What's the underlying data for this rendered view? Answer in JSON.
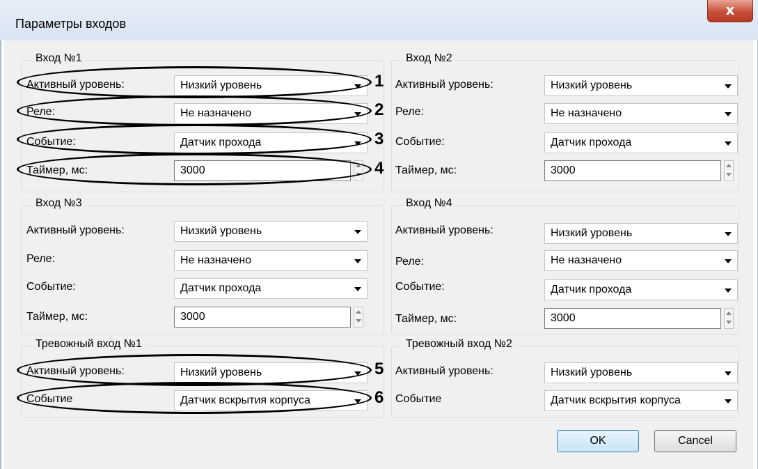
{
  "window": {
    "title": "Параметры входов",
    "close_glyph": "x"
  },
  "groups": {
    "in1": {
      "title": "Вход №1",
      "active_label": "Активный уровень:",
      "active_value": "Низкий уровень",
      "relay_label": "Реле:",
      "relay_value": "Не назначено",
      "event_label": "Событие:",
      "event_value": "Датчик прохода",
      "timer_label": "Таймер, мс:",
      "timer_value": "3000"
    },
    "in2": {
      "title": "Вход №2",
      "active_label": "Активный уровень:",
      "active_value": "Низкий уровень",
      "relay_label": "Реле:",
      "relay_value": "Не назначено",
      "event_label": "Событие:",
      "event_value": "Датчик прохода",
      "timer_label": "Таймер, мс:",
      "timer_value": "3000"
    },
    "in3": {
      "title": "Вход №3",
      "active_label": "Активный уровень:",
      "active_value": "Низкий уровень",
      "relay_label": "Реле:",
      "relay_value": "Не назначено",
      "event_label": "Событие:",
      "event_value": "Датчик прохода",
      "timer_label": "Таймер, мс:",
      "timer_value": "3000"
    },
    "in4": {
      "title": "Вход №4",
      "active_label": "Активный уровень:",
      "active_value": "Низкий уровень",
      "relay_label": "Реле:",
      "relay_value": "Не назначено",
      "event_label": "Событие:",
      "event_value": "Датчик прохода",
      "timer_label": "Таймер, мс:",
      "timer_value": "3000"
    },
    "alarm1": {
      "title": "Тревожный вход №1",
      "active_label": "Активный уровень:",
      "active_value": "Низкий уровень",
      "event_label": "Событие",
      "event_value": "Датчик вскрытия корпуса"
    },
    "alarm2": {
      "title": "Тревожный вход №2",
      "active_label": "Активный уровень:",
      "active_value": "Низкий уровень",
      "event_label": "Событие",
      "event_value": "Датчик вскрытия корпуса"
    }
  },
  "annotations": {
    "n1": "1",
    "n2": "2",
    "n3": "3",
    "n4": "4",
    "n5": "5",
    "n6": "6"
  },
  "buttons": {
    "ok": "OK",
    "cancel": "Cancel"
  },
  "icons": {
    "close": "close-icon",
    "dropdown": "chevron-down-icon",
    "spinner": "spinner-arrows-icon"
  },
  "colors": {
    "window_bg": "#f0f0f0",
    "close_button": "#c7503a",
    "ok_border": "#3c7fb1",
    "annotation": "#000000"
  }
}
